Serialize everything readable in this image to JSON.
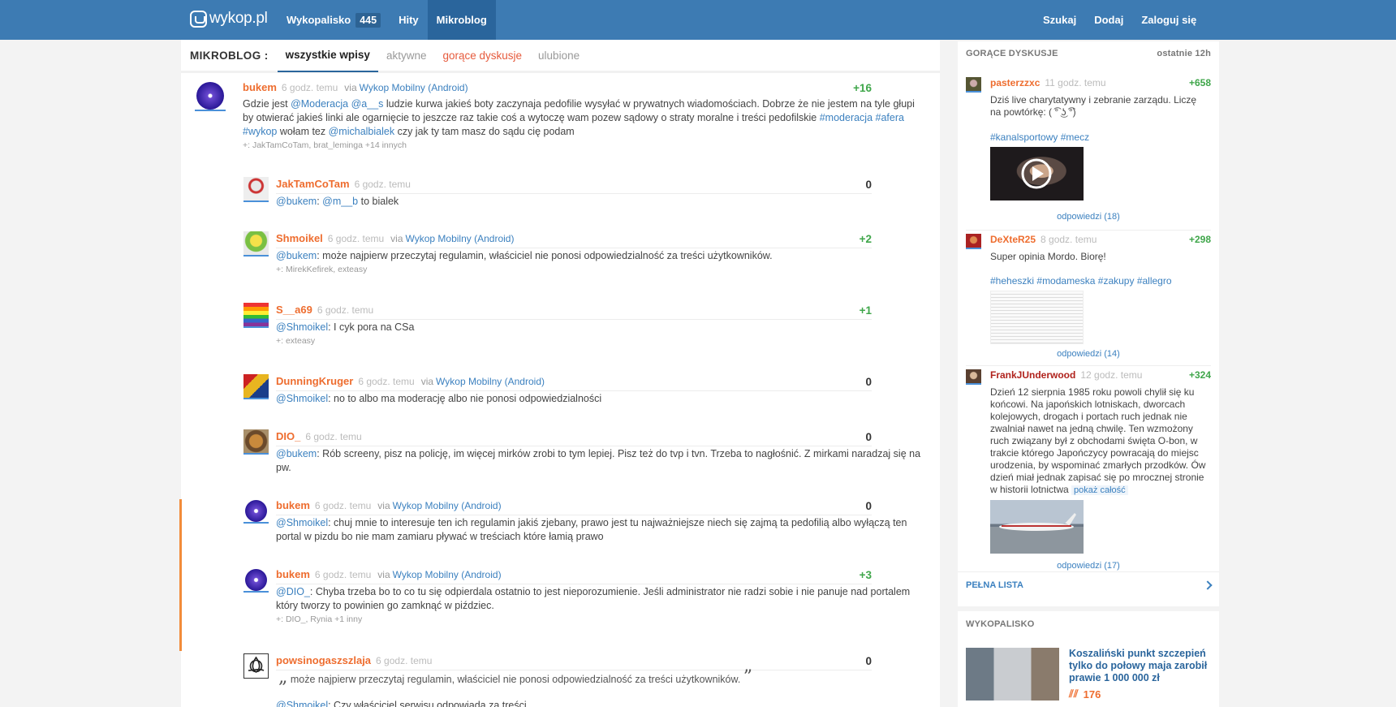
{
  "header": {
    "logo": "wykop.pl",
    "nav": [
      {
        "label": "Wykopalisko",
        "badge": "445"
      },
      {
        "label": "Hity"
      },
      {
        "label": "Mikroblog"
      }
    ],
    "right": [
      "Szukaj",
      "Dodaj",
      "Zaloguj się"
    ]
  },
  "subnav": {
    "title": "MIKROBLOG :",
    "tabs": [
      "wszystkie wpisy",
      "aktywne",
      "gorące dyskusje",
      "ulubione"
    ]
  },
  "entries": [
    {
      "nick": "bukem",
      "time": "6 godz. temu",
      "via": "via",
      "client": "Wykop Mobilny (Android)",
      "score": "+16",
      "parts": [
        "Gdzie jest ",
        "@Moderacja",
        " ",
        "@a__s",
        " ludzie kurwa jakieś boty zaczynaja pedofilie wysyłać w prywatnych wiadomościach. Dobrze że nie jestem na tyle głupi by otwierać jakieś linki ale ogarnięcie to jeszcze raz takie coś a wytoczę wam pozew sądowy o straty moralne i treści pedofilskie ",
        "#moderacja",
        " ",
        "#afera",
        " ",
        "#wykop",
        " wołam tez ",
        "@michalbialek",
        " czy jak ty tam masz do sądu cię podam"
      ],
      "plus": "+: JakTamCoTam, brat_leminga +14 innych"
    },
    {
      "nick": "JakTamCoTam",
      "time": "6 godz. temu",
      "score": "0",
      "parts": [
        "@bukem",
        ": ",
        "@m__b",
        " to bialek"
      ]
    },
    {
      "nick": "Shmoikel",
      "time": "6 godz. temu",
      "via": "via",
      "client": "Wykop Mobilny (Android)",
      "score": "+2",
      "parts": [
        "@bukem",
        ": może najpierw przeczytaj regulamin, właściciel nie ponosi odpowiedzialność za treści użytkowników."
      ],
      "plus": "+: MirekKefirek, exteasy"
    },
    {
      "nick": "S__a69",
      "time": "6 godz. temu",
      "score": "+1",
      "parts": [
        "@Shmoikel",
        ": I cyk pora na CSa"
      ],
      "plus": "+: exteasy"
    },
    {
      "nick": "DunningKruger",
      "time": "6 godz. temu",
      "via": "via",
      "client": "Wykop Mobilny (Android)",
      "score": "0",
      "parts": [
        "@Shmoikel",
        ": no to albo ma moderację albo nie ponosi odpowiedzialności"
      ]
    },
    {
      "nick": "DIO_",
      "time": "6 godz. temu",
      "score": "0",
      "parts": [
        "@bukem",
        ": Rób screeny, pisz na policję, im więcej mirków zrobi to tym lepiej. Pisz też do tvp i tvn. Trzeba to nagłośnić. Z mirkami naradzaj się na pw."
      ]
    },
    {
      "nick": "bukem",
      "time": "6 godz. temu",
      "via": "via",
      "client": "Wykop Mobilny (Android)",
      "score": "0",
      "parts": [
        "@Shmoikel",
        ": chuj mnie to interesuje ten ich regulamin jakiś zjebany, prawo jest tu najważniejsze niech się zajmą ta pedofilią albo wyłączą ten portal w pizdu bo nie mam zamiaru pływać w treściach które łamią prawo"
      ]
    },
    {
      "nick": "bukem",
      "time": "6 godz. temu",
      "via": "via",
      "client": "Wykop Mobilny (Android)",
      "score": "+3",
      "parts": [
        "@DIO_",
        ": Chyba trzeba bo to co tu się odpierdala ostatnio to jest nieporozumienie. Jeśli administrator nie radzi sobie i nie panuje nad portalem który tworzy to powinien go zamknąć w piździec."
      ],
      "plus": "+: DIO_, Rynia +1 inny"
    },
    {
      "nick": "powsinogaszszlaja",
      "time": "6 godz. temu",
      "score": "0",
      "quote": "może najpierw przeczytaj regulamin, właściciel nie ponosi odpowiedzialność za treści użytkowników.",
      "parts": [
        "@Shmoikel",
        ": Czy właściciel serwisu odpowiada za treści"
      ]
    }
  ],
  "sidebar": {
    "hot": {
      "title": "GORĄCE DYSKUSJE",
      "range": "ostatnie 12h",
      "items": [
        {
          "nick": "pasterzzxc",
          "time": "11 godz. temu",
          "score": "+658",
          "text": "Dziś live charytatywny i zebranie zarządu. Liczę na powtórkę: ( ͡° ͜ʖ ͡°)",
          "tags": [
            "#kanalsportowy",
            "#mecz"
          ],
          "replies": "odpowiedzi (18)"
        },
        {
          "nick": "DeXteR25",
          "time": "8 godz. temu",
          "score": "+298",
          "text": "Super opinia Mordo. Biorę!",
          "tags": [
            "#heheszki",
            "#modameska",
            "#zakupy",
            "#allegro"
          ],
          "replies": "odpowiedzi (14)"
        },
        {
          "nick": "FrankJUnderwood",
          "time": "12 godz. temu",
          "score": "+324",
          "text": "Dzień 12 sierpnia 1985 roku powoli chylił się ku końcowi. Na japońskich lotniskach, dworcach kolejowych, drogach i portach ruch jednak nie zwalniał nawet na jedną chwilę. Ten wzmożony ruch związany był z obchodami święta O-bon, w trakcie którego Japończycy powracają do miejsc urodzenia, by wspominać zmarłych przodków. Ów dzień miał jednak zapisać się po mrocznej stronie w historii lotnictwa",
          "more": "pokaż całość",
          "replies": "odpowiedzi (17)"
        }
      ],
      "full_list": "PEŁNA LISTA"
    },
    "wykopalisko": {
      "title": "WYKOPALISKO",
      "item_title": "Koszaliński punkt szczepień tylko do połowy maja zarobił prawie 1 000 000 zł",
      "votes": "176"
    }
  },
  "colors": {
    "brand": "#3d7bb3",
    "nick": "#ee6d2f",
    "link": "#3b80bf",
    "positive": "#3fa64a"
  }
}
